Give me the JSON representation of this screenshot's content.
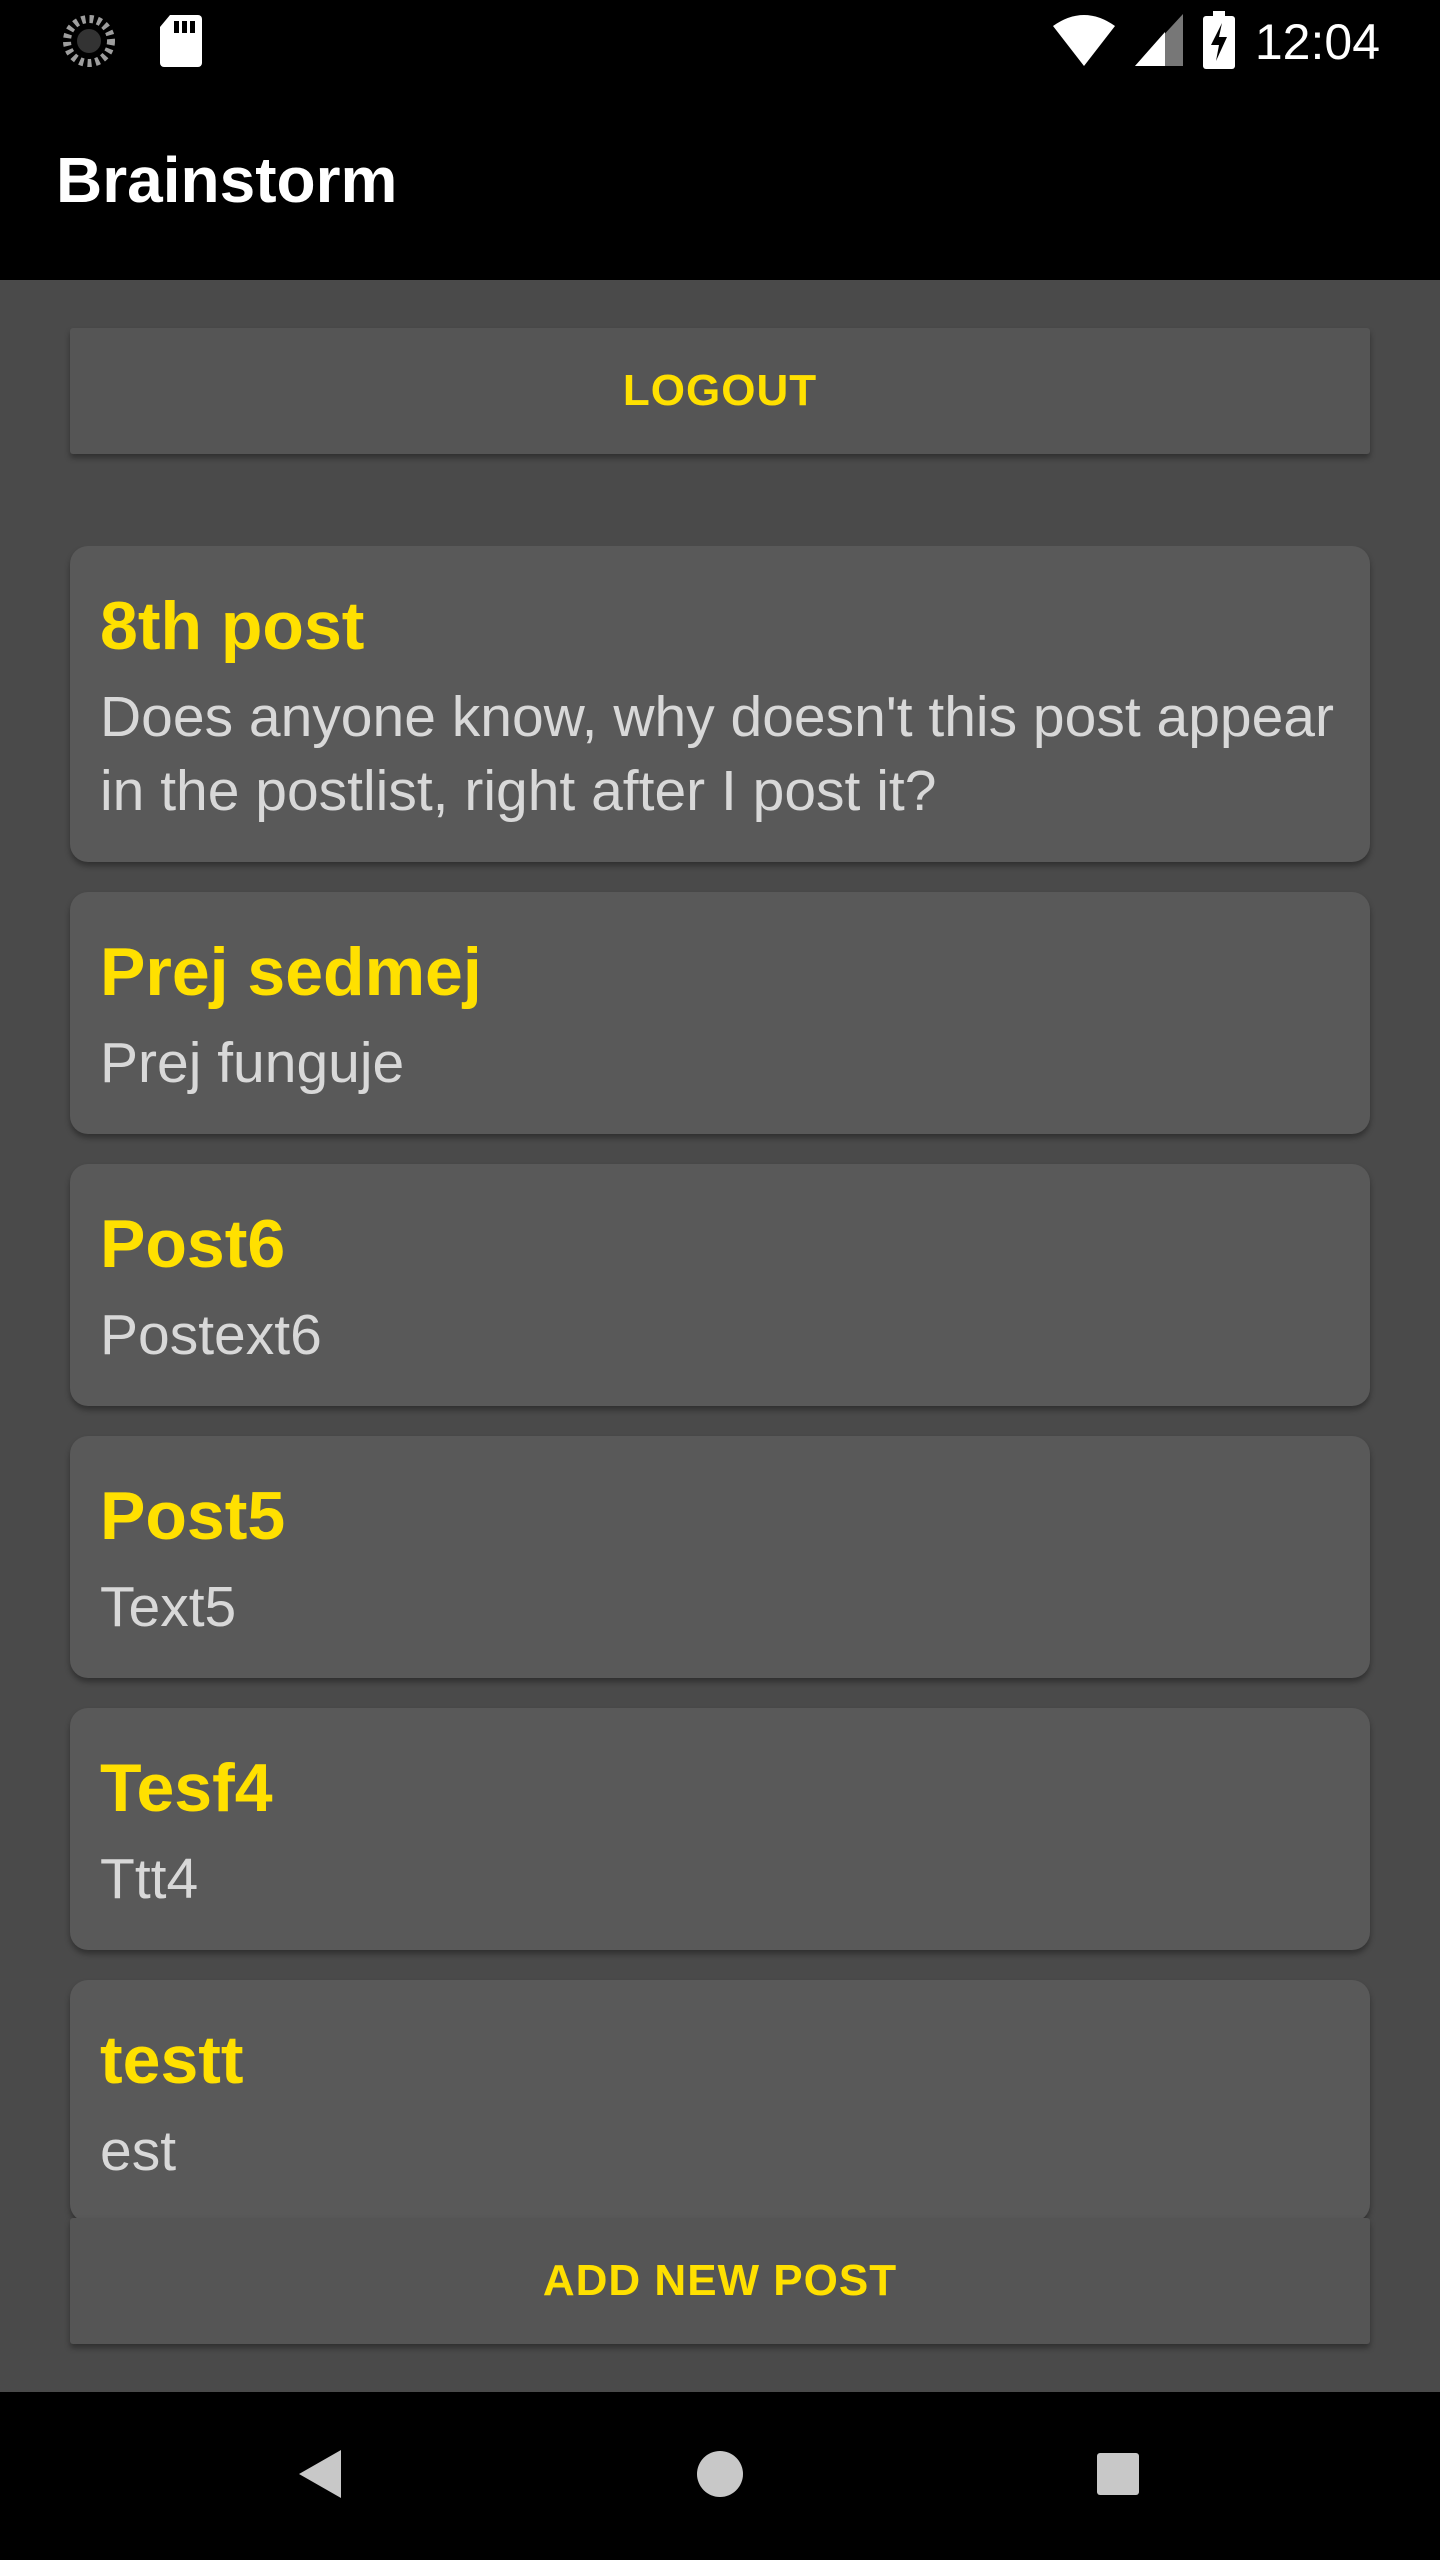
{
  "status_bar": {
    "time": "12:04",
    "icons": [
      "sync-icon",
      "sd-card-icon",
      "wifi-icon",
      "signal-icon",
      "battery-charging-icon"
    ]
  },
  "app_bar": {
    "title": "Brainstorm"
  },
  "buttons": {
    "logout": "LOGOUT",
    "add_new_post": "ADD NEW POST"
  },
  "posts": [
    {
      "title": "8th post",
      "text": "Does anyone know, why doesn't this post appear in the postlist, right after I post it?"
    },
    {
      "title": "Prej sedmej",
      "text": "Prej funguje"
    },
    {
      "title": "Post6",
      "text": "Postext6"
    },
    {
      "title": "Post5",
      "text": "Text5"
    },
    {
      "title": "Tesf4",
      "text": "Ttt4"
    },
    {
      "title": "testt",
      "text": "est"
    }
  ],
  "colors": {
    "accent": "#ffe000",
    "background": "#4a4a4a",
    "card": "#595959",
    "bar": "#000000"
  },
  "nav_bar": {
    "icons": [
      "back-icon",
      "home-icon",
      "recents-icon"
    ]
  }
}
